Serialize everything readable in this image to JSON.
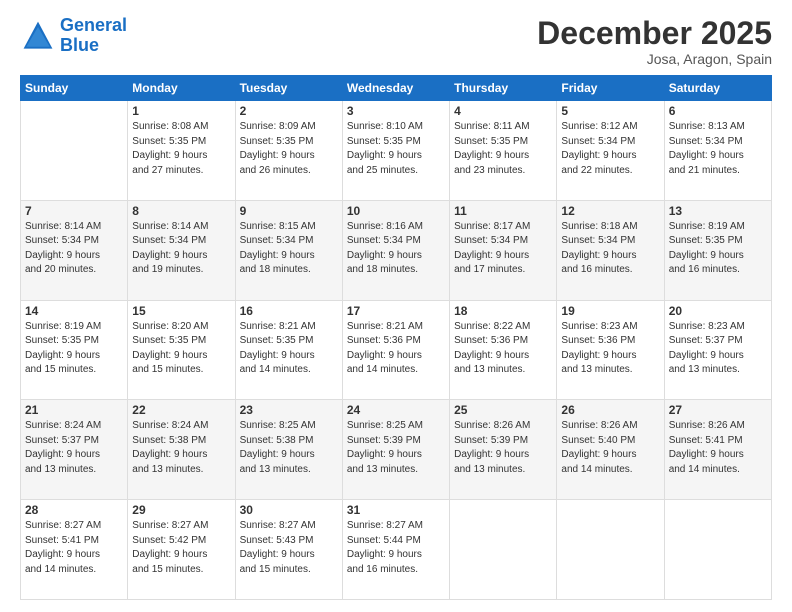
{
  "header": {
    "logo_line1": "General",
    "logo_line2": "Blue",
    "title": "December 2025",
    "subtitle": "Josa, Aragon, Spain"
  },
  "columns": [
    "Sunday",
    "Monday",
    "Tuesday",
    "Wednesday",
    "Thursday",
    "Friday",
    "Saturday"
  ],
  "weeks": [
    [
      {
        "day": "",
        "info": ""
      },
      {
        "day": "1",
        "info": "Sunrise: 8:08 AM\nSunset: 5:35 PM\nDaylight: 9 hours\nand 27 minutes."
      },
      {
        "day": "2",
        "info": "Sunrise: 8:09 AM\nSunset: 5:35 PM\nDaylight: 9 hours\nand 26 minutes."
      },
      {
        "day": "3",
        "info": "Sunrise: 8:10 AM\nSunset: 5:35 PM\nDaylight: 9 hours\nand 25 minutes."
      },
      {
        "day": "4",
        "info": "Sunrise: 8:11 AM\nSunset: 5:35 PM\nDaylight: 9 hours\nand 23 minutes."
      },
      {
        "day": "5",
        "info": "Sunrise: 8:12 AM\nSunset: 5:34 PM\nDaylight: 9 hours\nand 22 minutes."
      },
      {
        "day": "6",
        "info": "Sunrise: 8:13 AM\nSunset: 5:34 PM\nDaylight: 9 hours\nand 21 minutes."
      }
    ],
    [
      {
        "day": "7",
        "info": "Sunrise: 8:14 AM\nSunset: 5:34 PM\nDaylight: 9 hours\nand 20 minutes."
      },
      {
        "day": "8",
        "info": "Sunrise: 8:14 AM\nSunset: 5:34 PM\nDaylight: 9 hours\nand 19 minutes."
      },
      {
        "day": "9",
        "info": "Sunrise: 8:15 AM\nSunset: 5:34 PM\nDaylight: 9 hours\nand 18 minutes."
      },
      {
        "day": "10",
        "info": "Sunrise: 8:16 AM\nSunset: 5:34 PM\nDaylight: 9 hours\nand 18 minutes."
      },
      {
        "day": "11",
        "info": "Sunrise: 8:17 AM\nSunset: 5:34 PM\nDaylight: 9 hours\nand 17 minutes."
      },
      {
        "day": "12",
        "info": "Sunrise: 8:18 AM\nSunset: 5:34 PM\nDaylight: 9 hours\nand 16 minutes."
      },
      {
        "day": "13",
        "info": "Sunrise: 8:19 AM\nSunset: 5:35 PM\nDaylight: 9 hours\nand 16 minutes."
      }
    ],
    [
      {
        "day": "14",
        "info": "Sunrise: 8:19 AM\nSunset: 5:35 PM\nDaylight: 9 hours\nand 15 minutes."
      },
      {
        "day": "15",
        "info": "Sunrise: 8:20 AM\nSunset: 5:35 PM\nDaylight: 9 hours\nand 15 minutes."
      },
      {
        "day": "16",
        "info": "Sunrise: 8:21 AM\nSunset: 5:35 PM\nDaylight: 9 hours\nand 14 minutes."
      },
      {
        "day": "17",
        "info": "Sunrise: 8:21 AM\nSunset: 5:36 PM\nDaylight: 9 hours\nand 14 minutes."
      },
      {
        "day": "18",
        "info": "Sunrise: 8:22 AM\nSunset: 5:36 PM\nDaylight: 9 hours\nand 13 minutes."
      },
      {
        "day": "19",
        "info": "Sunrise: 8:23 AM\nSunset: 5:36 PM\nDaylight: 9 hours\nand 13 minutes."
      },
      {
        "day": "20",
        "info": "Sunrise: 8:23 AM\nSunset: 5:37 PM\nDaylight: 9 hours\nand 13 minutes."
      }
    ],
    [
      {
        "day": "21",
        "info": "Sunrise: 8:24 AM\nSunset: 5:37 PM\nDaylight: 9 hours\nand 13 minutes."
      },
      {
        "day": "22",
        "info": "Sunrise: 8:24 AM\nSunset: 5:38 PM\nDaylight: 9 hours\nand 13 minutes."
      },
      {
        "day": "23",
        "info": "Sunrise: 8:25 AM\nSunset: 5:38 PM\nDaylight: 9 hours\nand 13 minutes."
      },
      {
        "day": "24",
        "info": "Sunrise: 8:25 AM\nSunset: 5:39 PM\nDaylight: 9 hours\nand 13 minutes."
      },
      {
        "day": "25",
        "info": "Sunrise: 8:26 AM\nSunset: 5:39 PM\nDaylight: 9 hours\nand 13 minutes."
      },
      {
        "day": "26",
        "info": "Sunrise: 8:26 AM\nSunset: 5:40 PM\nDaylight: 9 hours\nand 14 minutes."
      },
      {
        "day": "27",
        "info": "Sunrise: 8:26 AM\nSunset: 5:41 PM\nDaylight: 9 hours\nand 14 minutes."
      }
    ],
    [
      {
        "day": "28",
        "info": "Sunrise: 8:27 AM\nSunset: 5:41 PM\nDaylight: 9 hours\nand 14 minutes."
      },
      {
        "day": "29",
        "info": "Sunrise: 8:27 AM\nSunset: 5:42 PM\nDaylight: 9 hours\nand 15 minutes."
      },
      {
        "day": "30",
        "info": "Sunrise: 8:27 AM\nSunset: 5:43 PM\nDaylight: 9 hours\nand 15 minutes."
      },
      {
        "day": "31",
        "info": "Sunrise: 8:27 AM\nSunset: 5:44 PM\nDaylight: 9 hours\nand 16 minutes."
      },
      {
        "day": "",
        "info": ""
      },
      {
        "day": "",
        "info": ""
      },
      {
        "day": "",
        "info": ""
      }
    ]
  ]
}
